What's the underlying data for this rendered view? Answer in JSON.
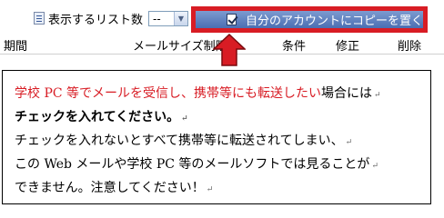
{
  "toolbar": {
    "list_count_label": "表示するリスト数",
    "list_count_value": "--",
    "copy_button_label": "自分のアカウントにコピーを置く"
  },
  "header": {
    "col_period": "期間",
    "col_mail_size": "メールサイズ制限",
    "col_condition": "条件",
    "col_edit": "修正",
    "col_delete": "削除"
  },
  "message": {
    "line1_red": "学校 PC 等でメールを受信し、携帯等にも転送したい",
    "line1_rest": "場合には",
    "line2": "チェックを入れてください。",
    "line3": "チェックを入れないとすべて携帯等に転送されてしまい、",
    "line4": "この Web メールや学校 PC 等のメールソフトでは見ることが",
    "line5": "できません。注意してください！",
    "para_mark": "↵"
  },
  "colors": {
    "highlight_red": "#d81c24",
    "button_blue": "#5a7dbf"
  }
}
